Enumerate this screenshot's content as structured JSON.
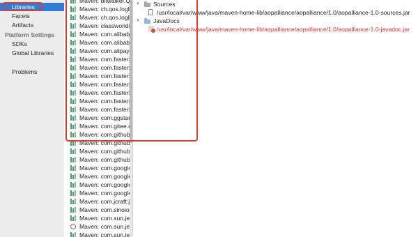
{
  "sidebar": {
    "items": [
      {
        "label": "Libraries",
        "type": "item",
        "selected": true
      },
      {
        "label": "Facets",
        "type": "item"
      },
      {
        "label": "Artifacts",
        "type": "item"
      },
      {
        "label": "Platform Settings",
        "type": "header"
      },
      {
        "label": "SDKs",
        "type": "item"
      },
      {
        "label": "Global Libraries",
        "type": "item"
      },
      {
        "label": "Problems",
        "type": "item"
      }
    ]
  },
  "libraries": [
    {
      "label": "Maven: bitwalker.UserAgentUtils",
      "icon": "library-icon"
    },
    {
      "label": "Maven: ch.qos.logback",
      "icon": "library-icon"
    },
    {
      "label": "Maven: ch.qos.logback",
      "icon": "library-icon"
    },
    {
      "label": "Maven: classworlds",
      "icon": "library-icon"
    },
    {
      "label": "Maven: com.alibaba",
      "icon": "library-icon"
    },
    {
      "label": "Maven: com.alibaba",
      "icon": "library-icon"
    },
    {
      "label": "Maven: com.alipay.s",
      "icon": "library-icon"
    },
    {
      "label": "Maven: com.fasterx",
      "icon": "library-icon"
    },
    {
      "label": "Maven: com.fasterx",
      "icon": "library-icon"
    },
    {
      "label": "Maven: com.fasterx",
      "icon": "library-icon"
    },
    {
      "label": "Maven: com.fasterx",
      "icon": "library-icon"
    },
    {
      "label": "Maven: com.fasterx",
      "icon": "library-icon"
    },
    {
      "label": "Maven: com.fasterx",
      "icon": "library-icon"
    },
    {
      "label": "Maven: com.fasterx",
      "icon": "library-icon"
    },
    {
      "label": "Maven: com.ggstar:",
      "icon": "library-icon"
    },
    {
      "label": "Maven: com.gitee.q",
      "icon": "library-icon"
    },
    {
      "label": "Maven: com.github.",
      "icon": "library-icon"
    },
    {
      "label": "Maven: com.github.",
      "icon": "library-icon"
    },
    {
      "label": "Maven: com.github.",
      "icon": "library-icon"
    },
    {
      "label": "Maven: com.github.",
      "icon": "library-icon"
    },
    {
      "label": "Maven: com.google",
      "icon": "library-icon"
    },
    {
      "label": "Maven: com.google",
      "icon": "library-icon"
    },
    {
      "label": "Maven: com.google",
      "icon": "library-icon"
    },
    {
      "label": "Maven: com.google",
      "icon": "library-icon"
    },
    {
      "label": "Maven: com.jcraft:js",
      "icon": "library-icon"
    },
    {
      "label": "Maven: com.sinoiov",
      "icon": "library-icon"
    },
    {
      "label": "Maven: com.sun.jer",
      "icon": "library-icon"
    },
    {
      "label": "Maven: com.sun.jer",
      "icon": "globe-icon"
    },
    {
      "label": "Maven: com.sun.jer",
      "icon": "library-icon"
    }
  ],
  "detail": {
    "sources_label": "Sources",
    "sources_path": "/usr/local/var/www/java/maven-home-lib/aopalliance/aopalliance/1.0/aopalliance-1.0-sources.jar",
    "javadocs_label": "JavaDocs",
    "javadocs_path": "/usr/local/var/www/java/maven-home-lib/aopalliance/aopalliance/1.0/aopalliance-1.0-javadoc.jar"
  },
  "colors": {
    "selection": "#2f7bd6",
    "annotation": "#e03a2e",
    "error_path": "#e3302b",
    "sidebar_bg": "#ececec"
  }
}
